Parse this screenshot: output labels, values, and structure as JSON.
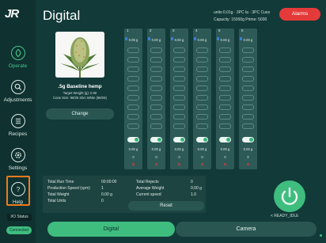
{
  "app": {
    "logo": "JR",
    "title": "Digital"
  },
  "header": {
    "status_line1": "units:0.01g · 3PC la · 3PC Cues",
    "status_line2": "Capacity: 15000g  Prime: 5000",
    "alarms_label": "Alarms",
    "alarms_color": "#e53a3a"
  },
  "sidebar": {
    "items": [
      {
        "label": "Operate",
        "icon": "leaf-icon",
        "active": true
      },
      {
        "label": "Adjustments",
        "icon": "magnify-icon",
        "active": false
      },
      {
        "label": "Recipes",
        "icon": "list-icon",
        "active": false
      },
      {
        "label": "Settings",
        "icon": "gear-icon",
        "active": false
      },
      {
        "label": "Help",
        "icon": "question-icon",
        "active": false
      }
    ],
    "io_status": "I/O Status",
    "connected": "Connected"
  },
  "product": {
    "name": ".5g Baseline hemp",
    "target_weight": "Target Weight (g): 0.50",
    "cone_size": "Cone Size: 98/26 Slim White (98/26)",
    "change_label": "Change"
  },
  "lanes": [
    {
      "number": "1",
      "weight": "0.05 g",
      "weight2": "0.00 g",
      "count": "0",
      "x": "⊠"
    },
    {
      "number": "2",
      "weight": "0.00 g",
      "weight2": "0.00 g",
      "count": "0",
      "x": "⊠"
    },
    {
      "number": "3",
      "weight": "0.00 g",
      "weight2": "0.00 g",
      "count": "0",
      "x": "⊠"
    },
    {
      "number": "4",
      "weight": "0.00 g",
      "weight2": "0.00 g",
      "count": "0",
      "x": "⊠"
    },
    {
      "number": "5",
      "weight": "0.00 g",
      "weight2": "0.00 g",
      "count": "0",
      "x": "⊠"
    },
    {
      "number": "6",
      "weight": "0.00 g",
      "weight2": "0.00 g",
      "count": "0",
      "x": "⊠"
    }
  ],
  "stats": {
    "left": [
      {
        "label": "Total Run Time",
        "value": "00:00:00"
      },
      {
        "label": "Production Speed (cpm)",
        "value": "1"
      },
      {
        "label": "Total Weight",
        "value": "0.00 g"
      },
      {
        "label": "Total Units",
        "value": "0"
      }
    ],
    "right": [
      {
        "label": "Total Rejects",
        "value": "0"
      },
      {
        "label": "Average Weight",
        "value": "0.00 g"
      },
      {
        "label": "Current speed",
        "value": "1.0"
      }
    ],
    "reset_label": "Reset"
  },
  "power": {
    "state_label": "< READY_IDLE",
    "color": "#3fbd7f"
  },
  "tabs": [
    {
      "label": "Digital",
      "active": true
    },
    {
      "label": "Camera",
      "active": false
    }
  ]
}
